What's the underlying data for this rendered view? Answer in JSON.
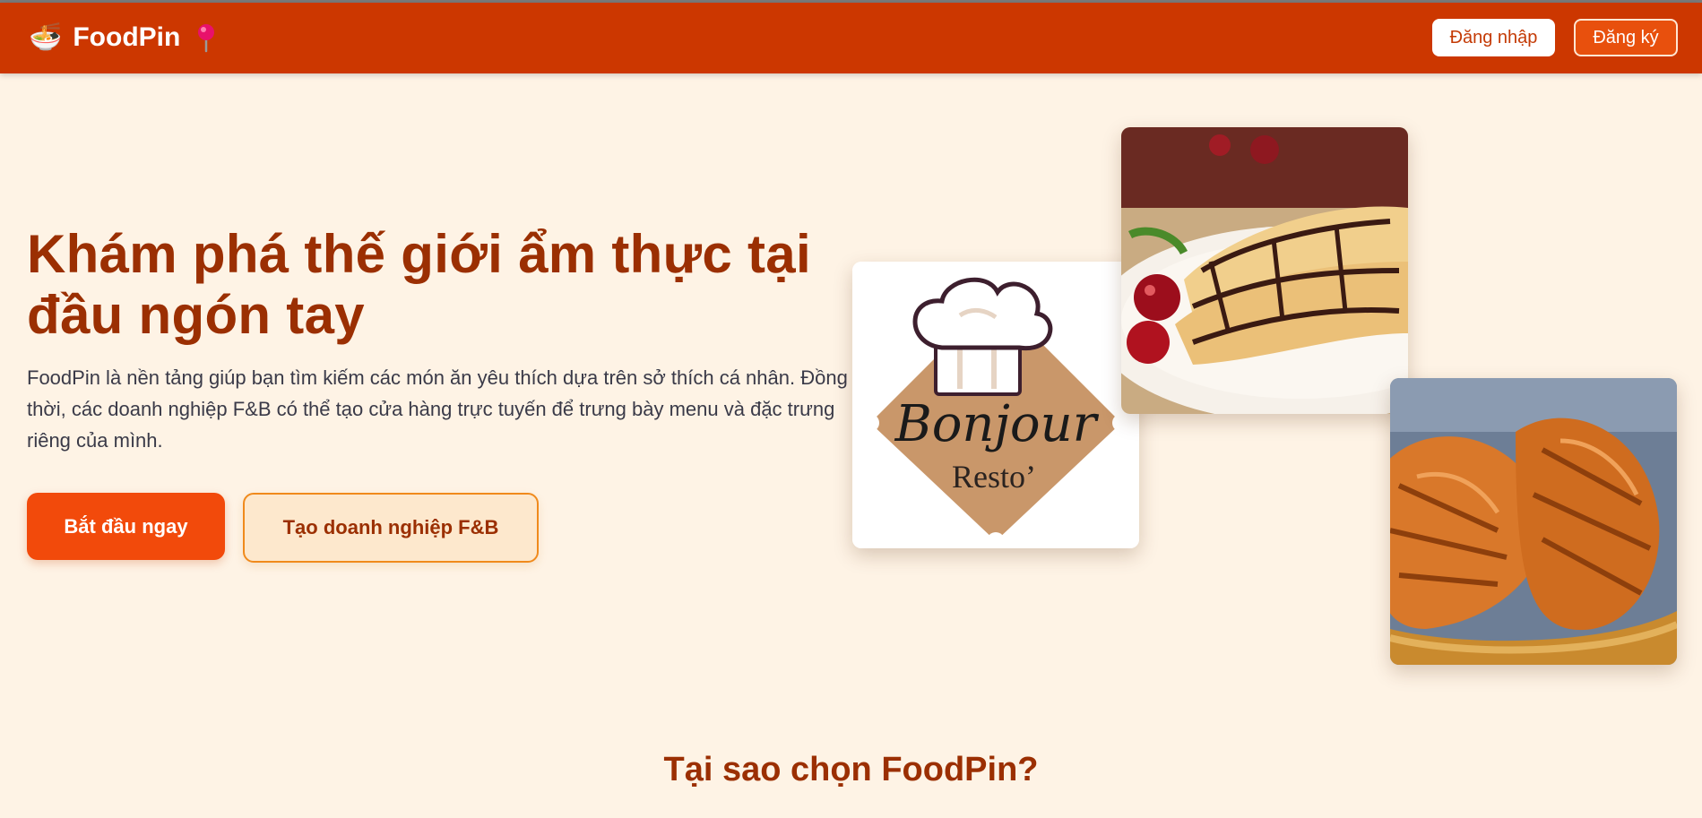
{
  "header": {
    "brand_emoji": "🍜",
    "brand_name": "FoodPin",
    "login_label": "Đăng nhập",
    "register_label": "Đăng ký"
  },
  "hero": {
    "title": "Khám phá thế giới ẩm thực tại đầu ngón tay",
    "description": "FoodPin là nền tảng giúp bạn tìm kiếm các món ăn yêu thích dựa trên sở thích cá nhân. Đồng thời, các doanh nghiệp F&B có thể tạo cửa hàng trực tuyến để trưng bày menu và đặc trưng riêng của mình.",
    "primary_button": "Bắt đầu ngay",
    "secondary_button": "Tạo doanh nghiệp F&B"
  },
  "gallery": {
    "logo_script": "Bonjour",
    "logo_sub": "Resto’"
  },
  "section": {
    "title": "Tại sao chọn FoodPin?"
  },
  "colors": {
    "navbar": "#cc3700",
    "page_background": "#fef3e5",
    "accent": "#f24a0b",
    "heading": "#9b2f02"
  }
}
